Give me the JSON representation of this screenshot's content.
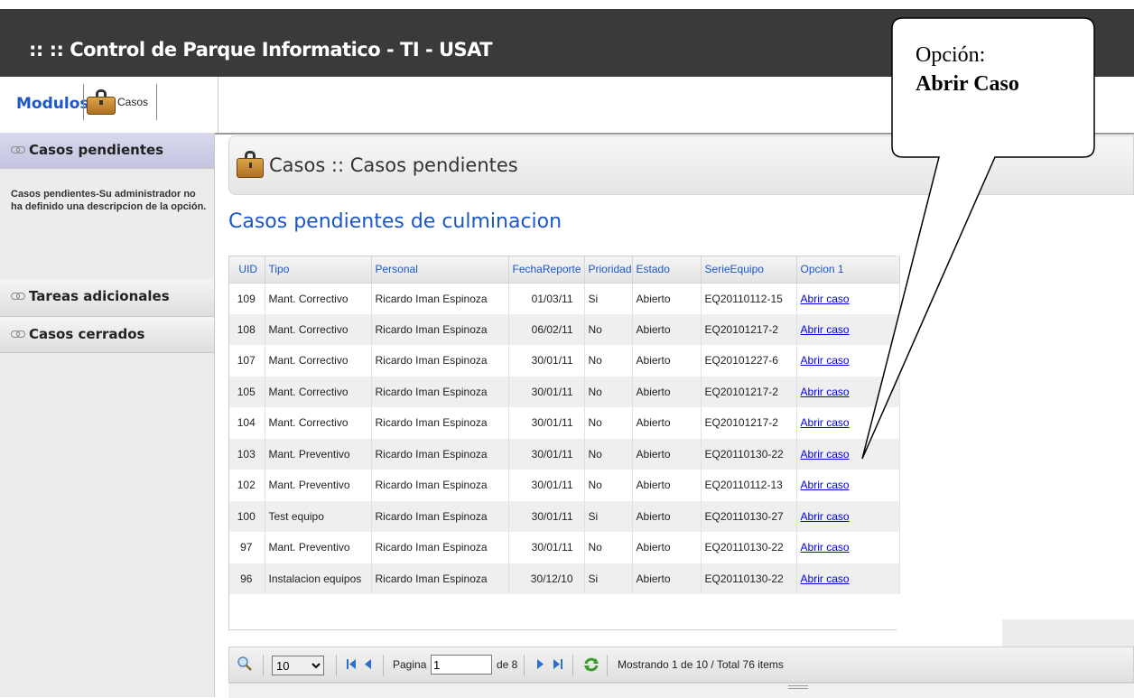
{
  "header": {
    "title": ":: :: Control de Parque Informatico - TI - USAT"
  },
  "navbar": {
    "modulos_label": "Modulos",
    "casos_tab_label": "Casos"
  },
  "sidebar": {
    "sections": [
      {
        "label": "Casos pendientes"
      },
      {
        "label": "Tareas adicionales"
      },
      {
        "label": "Casos cerrados"
      }
    ],
    "description": "Casos pendientes-Su administrador no ha definido una descripcion de la opción."
  },
  "content": {
    "breadcrumb": "Casos :: Casos pendientes",
    "heading": "Casos pendientes de culminacion"
  },
  "table": {
    "columns": [
      "UID",
      "Tipo",
      "Personal",
      "FechaReporte",
      "Prioridad",
      "Estado",
      "SerieEquipo",
      "Opcion 1"
    ],
    "rows": [
      [
        "109",
        "Mant. Correctivo",
        "Ricardo Iman Espinoza",
        "01/03/11",
        "Si",
        "Abierto",
        "EQ20110112-15",
        "Abrir caso"
      ],
      [
        "108",
        "Mant. Correctivo",
        "Ricardo Iman Espinoza",
        "06/02/11",
        "No",
        "Abierto",
        "EQ20101217-2",
        "Abrir caso"
      ],
      [
        "107",
        "Mant. Correctivo",
        "Ricardo Iman Espinoza",
        "30/01/11",
        "No",
        "Abierto",
        "EQ20101227-6",
        "Abrir caso"
      ],
      [
        "105",
        "Mant. Correctivo",
        "Ricardo Iman Espinoza",
        "30/01/11",
        "No",
        "Abierto",
        "EQ20101217-2",
        "Abrir caso"
      ],
      [
        "104",
        "Mant. Correctivo",
        "Ricardo Iman Espinoza",
        "30/01/11",
        "No",
        "Abierto",
        "EQ20101217-2",
        "Abrir caso"
      ],
      [
        "103",
        "Mant. Preventivo",
        "Ricardo Iman Espinoza",
        "30/01/11",
        "No",
        "Abierto",
        "EQ20110130-22",
        "Abrir caso"
      ],
      [
        "102",
        "Mant. Preventivo",
        "Ricardo Iman Espinoza",
        "30/01/11",
        "No",
        "Abierto",
        "EQ20110112-13",
        "Abrir caso"
      ],
      [
        "100",
        "Test equipo",
        "Ricardo Iman Espinoza",
        "30/01/11",
        "Si",
        "Abierto",
        "EQ20110130-27",
        "Abrir caso"
      ],
      [
        "97",
        "Mant. Preventivo",
        "Ricardo Iman Espinoza",
        "30/01/11",
        "No",
        "Abierto",
        "EQ20110130-22",
        "Abrir caso"
      ],
      [
        "96",
        "Instalacion equipos",
        "Ricardo Iman Espinoza",
        "30/12/10",
        "Si",
        "Abierto",
        "EQ20110130-22",
        "Abrir caso"
      ]
    ]
  },
  "pager": {
    "rows_per_page": "10",
    "page_label": "Pagina",
    "page_value": "1",
    "of_label": "de 8",
    "status": "Mostrando 1 de 10 / Total 76 items"
  },
  "callout": {
    "line1": "Opción:",
    "line2": "Abrir Caso"
  },
  "colors": {
    "link_blue": "#1a57c9",
    "header_dark": "#3a3a3a"
  }
}
